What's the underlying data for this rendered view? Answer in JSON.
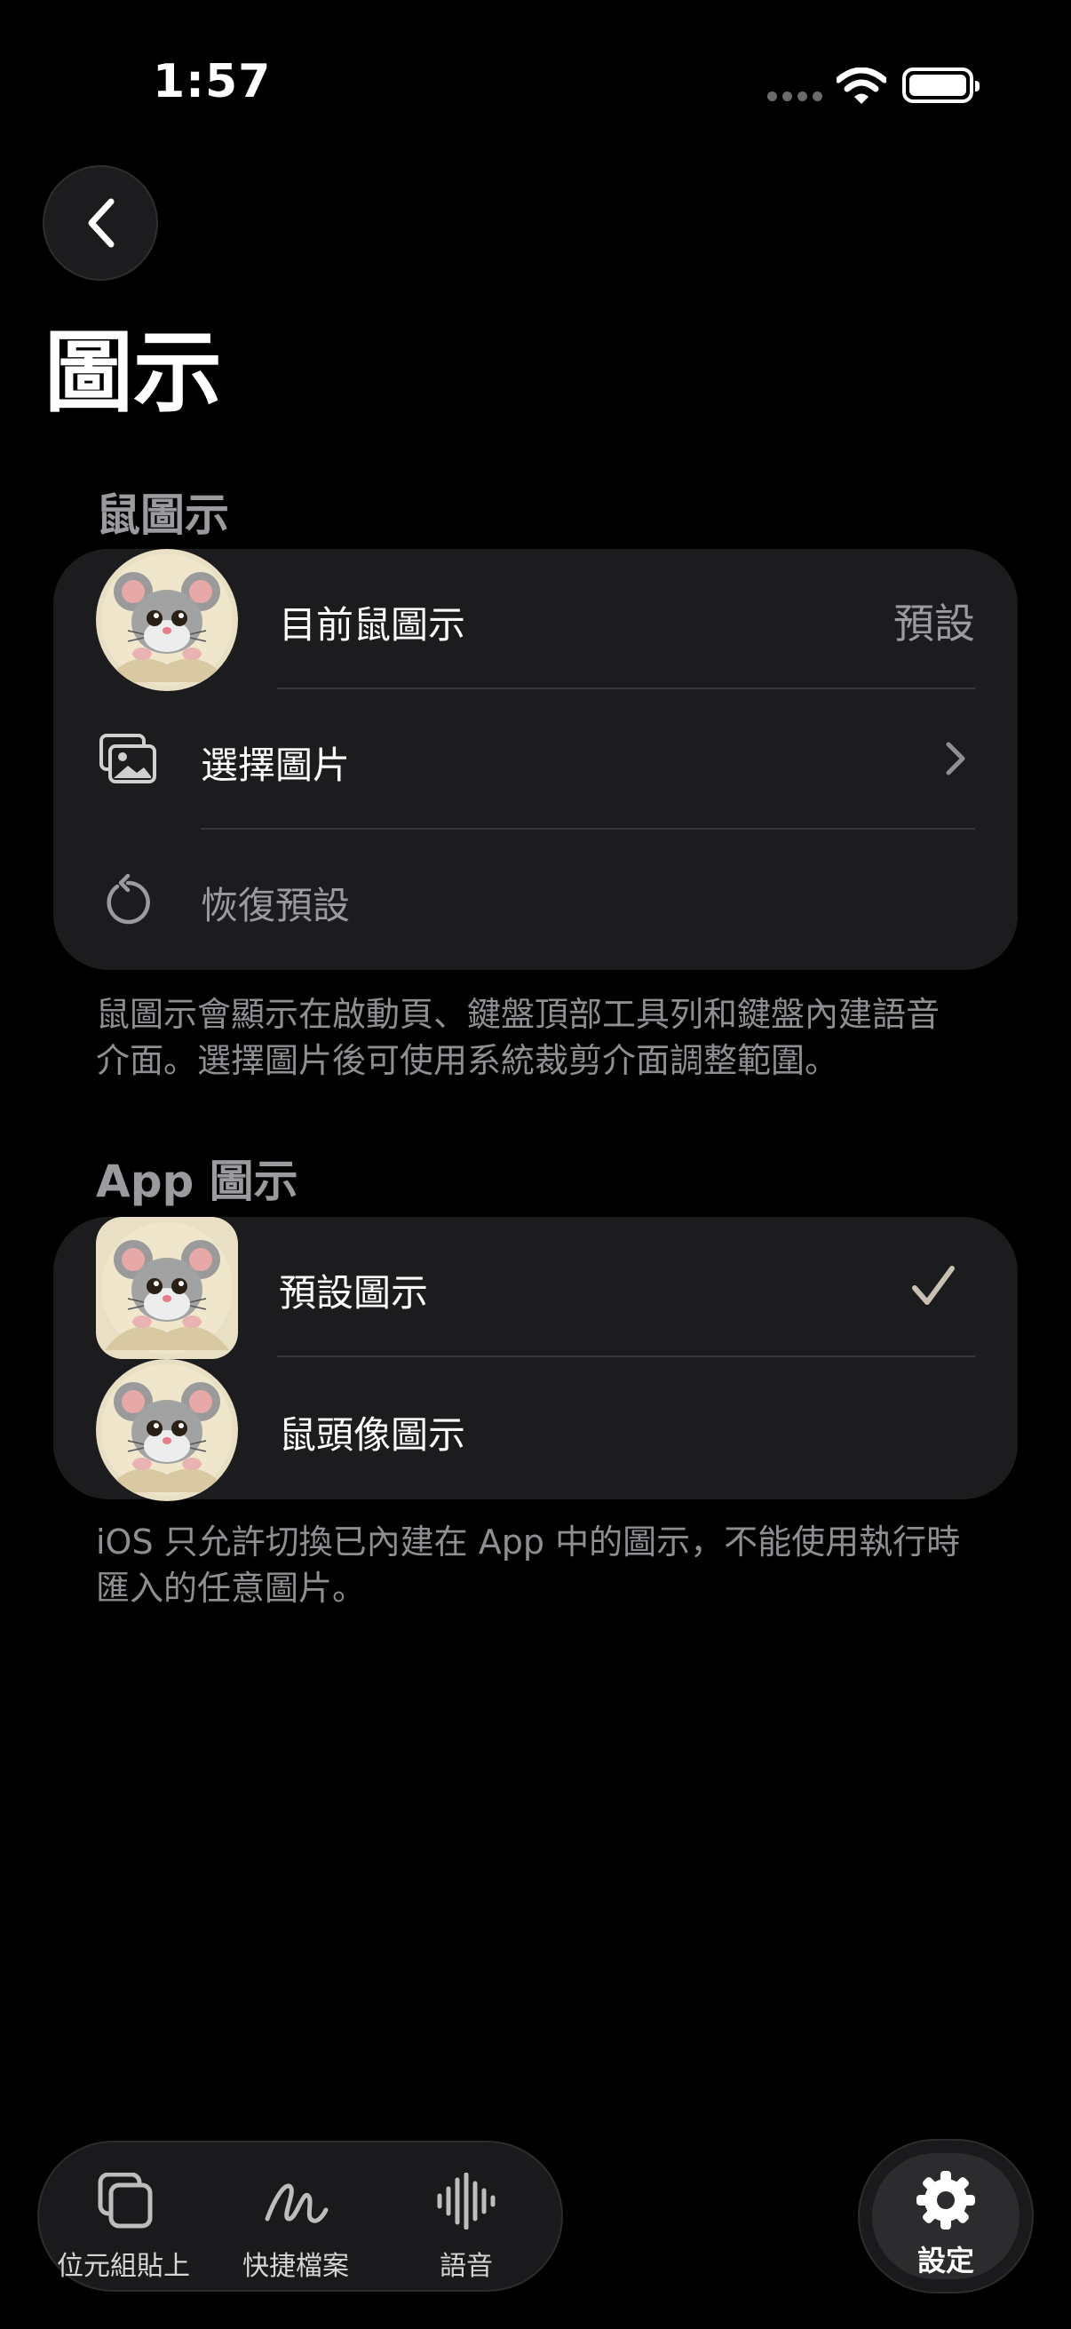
{
  "status": {
    "time": "1:57"
  },
  "nav": {
    "back_icon": "chevron-left-icon",
    "title": "圖示"
  },
  "mouse_section": {
    "header": "鼠圖示",
    "current_label": "目前鼠圖示",
    "current_value": "預設",
    "choose_label": "選擇圖片",
    "restore_label": "恢復預設",
    "footnote_line1": "鼠圖示會顯示在啟動頁、鍵盤頂部工具列和鍵盤內建語音",
    "footnote_line2": "介面。選擇圖片後可使用系統裁剪介面調整範圍。"
  },
  "app_section": {
    "header": "App 圖示",
    "options": [
      {
        "label": "預設圖示",
        "selected": true
      },
      {
        "label": "鼠頭像圖示",
        "selected": false
      }
    ],
    "footnote_line1": "iOS 只允許切換已內建在 App 中的圖示，不能使用執行時",
    "footnote_line2": "匯入的任意圖片。"
  },
  "tabbar": {
    "tabs": [
      {
        "label": "位元組貼上",
        "icon": "copy-icon"
      },
      {
        "label": "快捷檔案",
        "icon": "scribble-icon"
      },
      {
        "label": "語音",
        "icon": "waveform-icon"
      }
    ],
    "settings_label": "設定",
    "settings_icon": "gear-icon"
  },
  "colors": {
    "background": "#000000",
    "card": "#1c1c1e",
    "checkmark": "#c8c1b3"
  }
}
